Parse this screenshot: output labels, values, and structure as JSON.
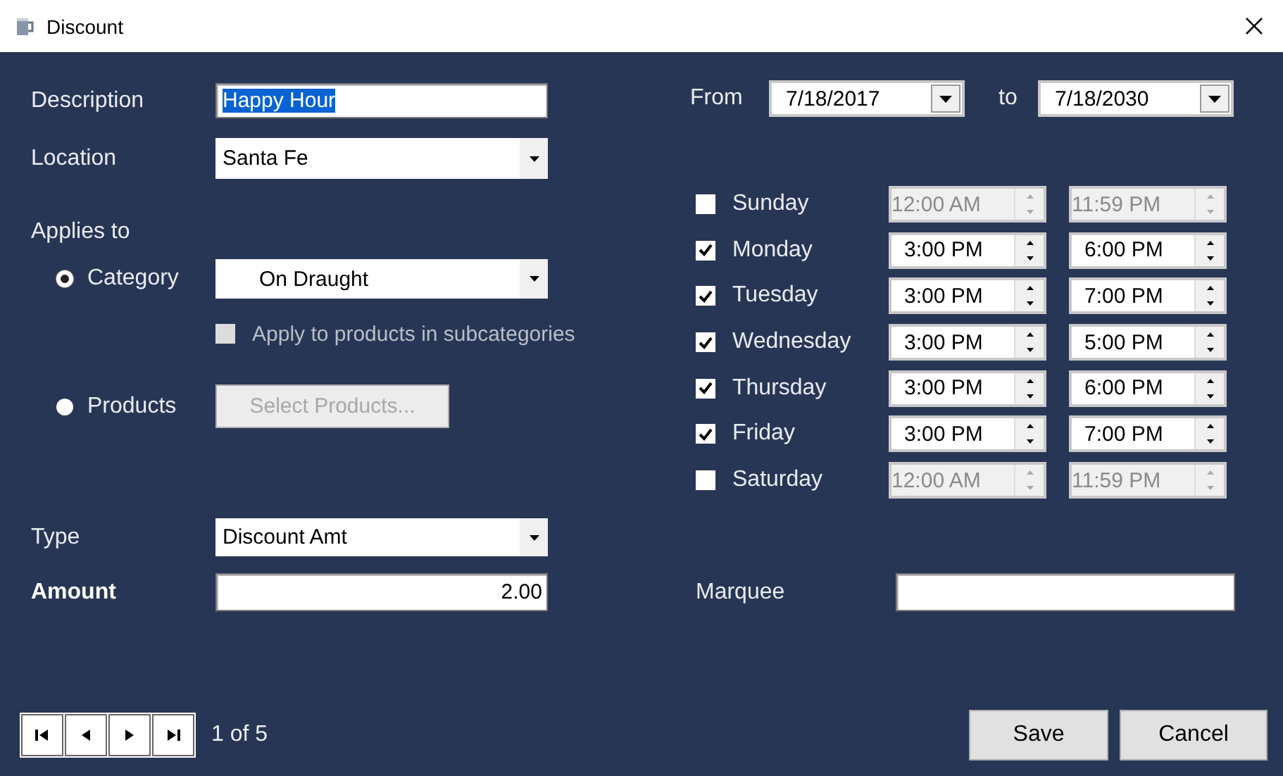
{
  "window": {
    "title": "Discount"
  },
  "form": {
    "description": {
      "label": "Description",
      "value": "Happy Hour",
      "text_selected": true
    },
    "location": {
      "label": "Location",
      "value": "Santa Fe"
    },
    "applies_to": {
      "label": "Applies to",
      "options": [
        {
          "label": "Category",
          "selected": true
        },
        {
          "label": "Products",
          "selected": false
        }
      ]
    },
    "category": {
      "value": "On Draught"
    },
    "subcategories": {
      "label": "Apply to products in subcategories",
      "checked": false,
      "disabled": true
    },
    "select_products": {
      "label": "Select Products...",
      "disabled": true
    },
    "type": {
      "label": "Type",
      "value": "Discount Amt"
    },
    "amount": {
      "label": "Amount",
      "value": "2.00"
    }
  },
  "schedule": {
    "from_label": "From",
    "from": "7/18/2017",
    "to_label": "to",
    "to": "7/18/2030",
    "days": [
      {
        "name": "Sunday",
        "checked": false,
        "start": "12:00 AM",
        "end": "11:59 PM"
      },
      {
        "name": "Monday",
        "checked": true,
        "start": "3:00 PM",
        "end": "6:00 PM"
      },
      {
        "name": "Tuesday",
        "checked": true,
        "start": "3:00 PM",
        "end": "7:00 PM"
      },
      {
        "name": "Wednesday",
        "checked": true,
        "start": "3:00 PM",
        "end": "5:00 PM"
      },
      {
        "name": "Thursday",
        "checked": true,
        "start": "3:00 PM",
        "end": "6:00 PM"
      },
      {
        "name": "Friday",
        "checked": true,
        "start": "3:00 PM",
        "end": "7:00 PM"
      },
      {
        "name": "Saturday",
        "checked": false,
        "start": "12:00 AM",
        "end": "11:59 PM"
      }
    ],
    "marquee": {
      "label": "Marquee"
    }
  },
  "pager": {
    "position": "1 of 5"
  },
  "buttons": [
    {
      "label": "Save"
    },
    {
      "label": "Cancel"
    }
  ]
}
